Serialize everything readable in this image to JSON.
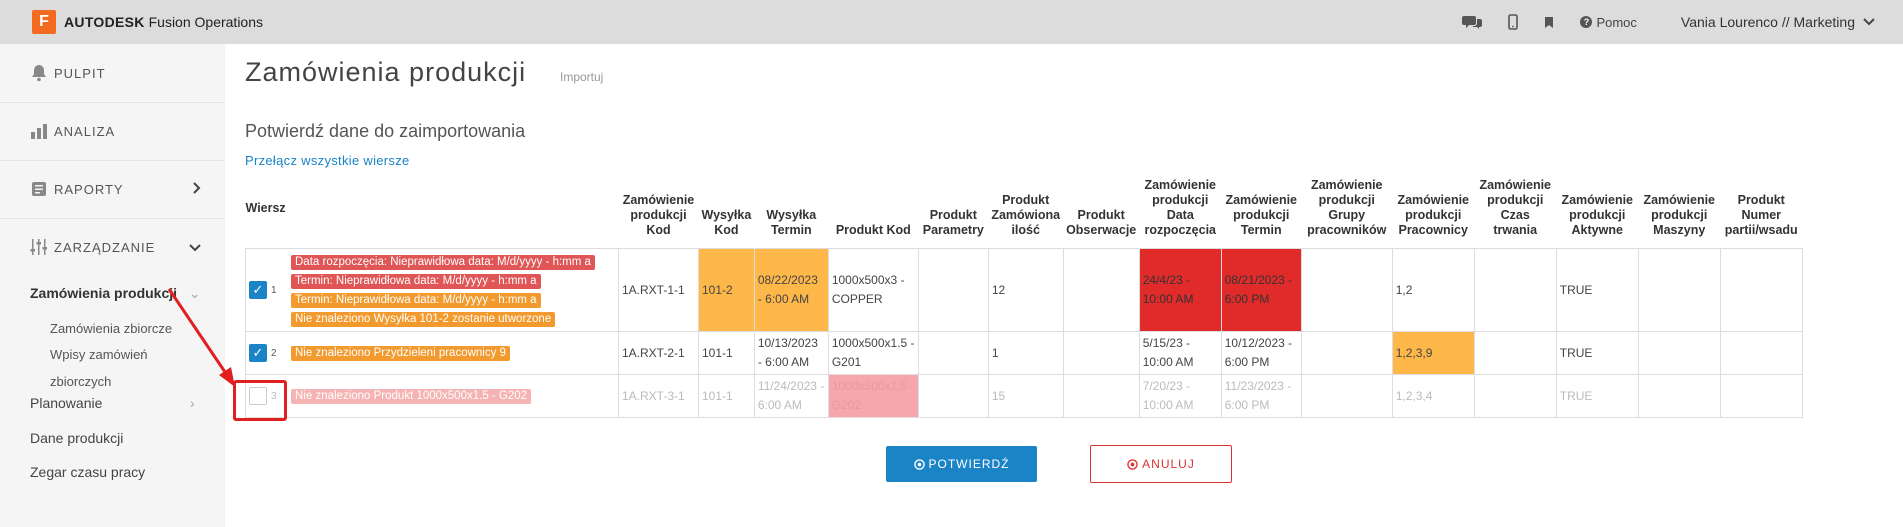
{
  "topbar": {
    "logo_letter": "F",
    "brand_bold": "AUTODESK",
    "brand_rest": " Fusion Operations",
    "help_label": "Pomoc",
    "user_label": "Vania Lourenco // Marketing",
    "icons": [
      "chat-icon",
      "mobile-icon",
      "bookmark-icon",
      "help-icon",
      "chevron-down-icon"
    ]
  },
  "sidebar": {
    "items": [
      {
        "label": "PULPIT",
        "icon": "bell-icon"
      },
      {
        "label": "ANALIZA",
        "icon": "bar-chart-icon"
      },
      {
        "label": "RAPORTY",
        "icon": "report-icon"
      },
      {
        "label": "ZARZĄDZANIE",
        "icon": "sliders-icon"
      }
    ],
    "active_sub": "Zamówienia produkcji",
    "subsub": [
      "Zamówienia zbiorcze",
      "Wpisy zamówień",
      "zbiorczych"
    ],
    "plain": [
      "Planowanie",
      "Dane produkcji",
      "Zegar czasu pracy"
    ]
  },
  "main": {
    "title": "Zamówienia produkcji",
    "import_link": "Importuj",
    "subtitle": "Potwierdź dane do zaimportowania",
    "toggle_link": "Przełącz wszystkie wiersze"
  },
  "table": {
    "headers": [
      "Wiersz",
      "Zamówienie produkcji Kod",
      "Wysyłka Kod",
      "Wysyłka Termin",
      "Produkt Kod",
      "Produkt Parametry",
      "Produkt Zamówiona ilość",
      "Produkt Obserwacje",
      "Zamówienie produkcji Data rozpoczęcia",
      "Zamówienie produkcji Termin",
      "Zamówienie produkcji Grupy pracowników",
      "Zamówienie produkcji Pracownicy",
      "Zamówienie produkcji Czas trwania",
      "Zamówienie produkcji Aktywne",
      "Zamówienie produkcji Maszyny",
      "Produkt Numer partii/wsadu"
    ],
    "rows": [
      {
        "num": "1",
        "checked": "✓",
        "messages": [
          {
            "text": "Data rozpoczęcia: Nieprawidłowa data: M/d/yyyy - h:mm a",
            "color": "#e05555"
          },
          {
            "text": "Termin: Nieprawidłowa data: M/d/yyyy - h:mm a",
            "color": "#e05555"
          },
          {
            "text": "Termin: Nieprawidłowa data: M/d/yyyy - h:mm a",
            "color": "#f29a2e"
          },
          {
            "text": "Nie znaleziono Wysyłka 101-2 zostanie utworzone",
            "color": "#f29a2e"
          }
        ],
        "kod": "1A.RXT-1-1",
        "wysylka_kod": "101-2",
        "wysylka_termin": "08/22/2023 - 6:00 AM",
        "produkt_kod": "1000x500x3 - COPPER",
        "parametry": "",
        "ilosc": "12",
        "obserwacje": "",
        "data_rozp": "24/4/23 - 10:00 AM",
        "termin": "08/21/2023 - 6:00 PM",
        "grupy": "",
        "pracownicy": "1,2",
        "czas": "",
        "aktywne": "TRUE",
        "maszyny": "",
        "partia": ""
      },
      {
        "num": "2",
        "checked": "✓",
        "messages": [
          {
            "text": "Nie znaleziono Przydzieleni pracownicy 9",
            "color": "#f29a2e"
          }
        ],
        "kod": "1A.RXT-2-1",
        "wysylka_kod": "101-1",
        "wysylka_termin": "10/13/2023 - 6:00 AM",
        "produkt_kod": "1000x500x1.5 - G201",
        "parametry": "",
        "ilosc": "1",
        "obserwacje": "",
        "data_rozp": "5/15/23 - 10:00 AM",
        "termin": "10/12/2023 - 6:00 PM",
        "grupy": "",
        "pracownicy": "1,2,3,9",
        "czas": "",
        "aktywne": "TRUE",
        "maszyny": "",
        "partia": ""
      },
      {
        "num": "3",
        "checked": "",
        "messages": [
          {
            "text": "Nie znaleziono Produkt 1000x500x1.5 - G202",
            "color": "#f5b3b3"
          }
        ],
        "kod": "1A.RXT-3-1",
        "wysylka_kod": "101-1",
        "wysylka_termin": "11/24/2023 - 6:00 AM",
        "produkt_kod": "1000x500x1.5 - G202",
        "parametry": "",
        "ilosc": "15",
        "obserwacje": "",
        "data_rozp": "7/20/23 - 10:00 AM",
        "termin": "11/23/2023 - 6:00 PM",
        "grupy": "",
        "pracownicy": "1,2,3,4",
        "czas": "",
        "aktywne": "TRUE",
        "maszyny": "",
        "partia": ""
      }
    ]
  },
  "buttons": {
    "confirm": "POTWIERDŹ",
    "cancel": "ANULUJ"
  },
  "colors": {
    "accent": "#1a84c7",
    "warning": "#fdb849",
    "error": "#e12b2b",
    "brand": "#f26b21"
  }
}
